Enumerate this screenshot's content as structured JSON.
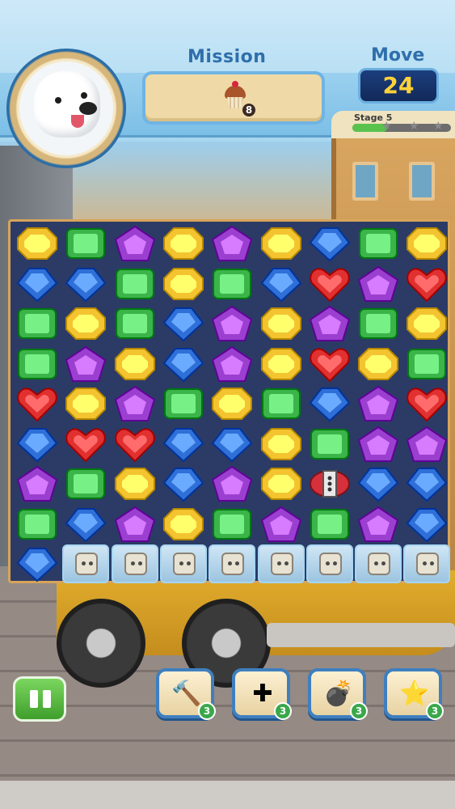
{
  "header": {
    "mission_label": "Mission",
    "mission_target_count": "8",
    "mission_target_icon": "cupcake-icon",
    "move_label": "Move",
    "moves_left": "24",
    "stage_label": "Stage 5",
    "stage_progress": 0.35,
    "stage_stars_earned": 0,
    "stage_stars_total": 3
  },
  "board": {
    "rows": 9,
    "cols": 9,
    "grid": [
      [
        "Y",
        "G",
        "P",
        "Y",
        "P",
        "Y",
        "B",
        "G",
        "Y"
      ],
      [
        "B",
        "B",
        "G",
        "Y",
        "G",
        "B",
        "R",
        "P",
        "R"
      ],
      [
        "G",
        "Y",
        "G",
        "B",
        "P",
        "Y",
        "P",
        "G",
        "Y"
      ],
      [
        "G",
        "P",
        "Y",
        "B",
        "P",
        "Y",
        "R",
        "Y",
        "G"
      ],
      [
        "R",
        "Y",
        "P",
        "G",
        "Y",
        "G",
        "B",
        "P",
        "R"
      ],
      [
        "B",
        "R",
        "R",
        "B",
        "B",
        "Y",
        "G",
        "P",
        "P"
      ],
      [
        "P",
        "G",
        "Y",
        "B",
        "P",
        "Y",
        "X",
        "B",
        "B"
      ],
      [
        "G",
        "B",
        "P",
        "Y",
        "G",
        "P",
        "G",
        "P",
        "B"
      ],
      [
        "B",
        "C",
        "C",
        "C",
        "C",
        "C",
        "C",
        "C",
        "C"
      ]
    ],
    "legend": {
      "Y": "yellow-gem",
      "G": "green-gem",
      "P": "purple-gem",
      "B": "blue-gem",
      "R": "red-heart-gem",
      "X": "striped-bomb",
      "C": "ice-crate"
    },
    "colors": {
      "yellow": "#f4c430",
      "green": "#3bb54a",
      "purple": "#9b3fd1",
      "blue": "#2f6fd8",
      "red": "#e0302f"
    }
  },
  "boosters": [
    {
      "name": "hammer",
      "icon": "hammer-icon",
      "count": "3"
    },
    {
      "name": "cross-blast",
      "icon": "cross-arrows-icon",
      "count": "3"
    },
    {
      "name": "bomb",
      "icon": "bomb-icon",
      "count": "3"
    },
    {
      "name": "rainbow-star",
      "icon": "rainbow-star-icon",
      "count": "3"
    }
  ],
  "controls": {
    "pause_icon": "pause-icon"
  }
}
